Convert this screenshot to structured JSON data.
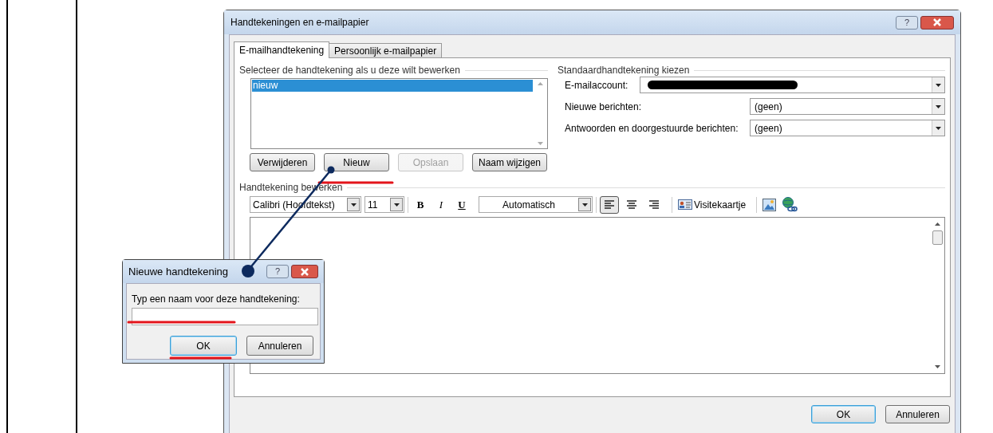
{
  "window": {
    "title": "Handtekeningen en e-mailpapier",
    "help": "?"
  },
  "tabs": [
    {
      "label": "E-mailhandtekening",
      "selected": true
    },
    {
      "label": "Persoonlijk e-mailpapier",
      "selected": false
    }
  ],
  "signatures": {
    "label": "Selecteer de handtekening als u deze wilt bewerken",
    "items": [
      {
        "label": "nieuw",
        "selected": true
      }
    ]
  },
  "signature_buttons": [
    {
      "label": "Verwijderen",
      "disabled": false
    },
    {
      "label": "Nieuw",
      "disabled": false
    },
    {
      "label": "Opslaan",
      "disabled": true
    },
    {
      "label": "Naam wijzigen",
      "disabled": false
    }
  ],
  "defaults": {
    "label": "Standaardhandtekening kiezen",
    "fields": [
      {
        "kind": "account",
        "label": "E-mailaccount:",
        "redacted": true
      },
      {
        "kind": "choice",
        "label": "Nieuwe berichten:",
        "value": "(geen)"
      },
      {
        "kind": "choice",
        "label": "Antwoorden en doorgestuurde berichten:",
        "value": "(geen)"
      }
    ]
  },
  "editor": {
    "label": "Handtekening bewerken",
    "font": "Calibri (Hoofdtekst)",
    "size": "11",
    "bold": "B",
    "italic": "I",
    "underline": "U",
    "font_color_choice": "Automatisch",
    "align": [
      {
        "kind": "left",
        "selected": true
      },
      {
        "kind": "center",
        "selected": false
      },
      {
        "kind": "right",
        "selected": false
      }
    ],
    "business_card": "Visitekaartje"
  },
  "buttons": [
    {
      "label": "OK",
      "default": true
    },
    {
      "label": "Annuleren",
      "default": false
    }
  ],
  "dialog": {
    "title": "Nieuwe handtekening",
    "help": "?",
    "prompt": "Typ een naam voor deze handtekening:",
    "buttons": [
      {
        "label": "OK",
        "default": true
      },
      {
        "label": "Annuleren",
        "default": false
      }
    ]
  }
}
